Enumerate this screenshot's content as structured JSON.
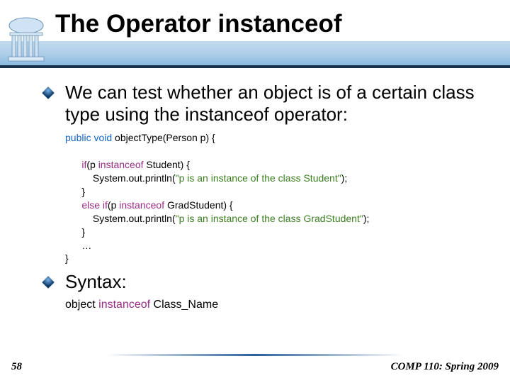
{
  "title": "The Operator instanceof",
  "bullets": [
    {
      "text": "We can test whether an object is of a certain class type using the instanceof operator:",
      "code": {
        "sig_kw": "public void ",
        "sig_name": "objectType(Person p) {",
        "if_kw": "if",
        "if_cond_open": "(p ",
        "instanceof_kw": "instanceof",
        "if_cond_close1": " Student) {",
        "println1a": "System.out.println(",
        "str1": "\"p is an instance of the class Student\"",
        "println1b": ");",
        "brace1": "}",
        "else_kw": "else if",
        "elif_cond_open": "(p ",
        "elif_cond_close": " GradStudent) {",
        "println2a": "System.out.println(",
        "str2": "\"p is an instance of the class GradStudent\"",
        "println2b": ");",
        "brace2": "}",
        "dots": "…",
        "brace_end": "}"
      }
    },
    {
      "text": "Syntax:",
      "syntax": {
        "obj": "object ",
        "kw": "instanceof",
        "cls": " Class_Name"
      }
    }
  ],
  "footer": {
    "page": "58",
    "course": "COMP 110: Spring 2009"
  }
}
